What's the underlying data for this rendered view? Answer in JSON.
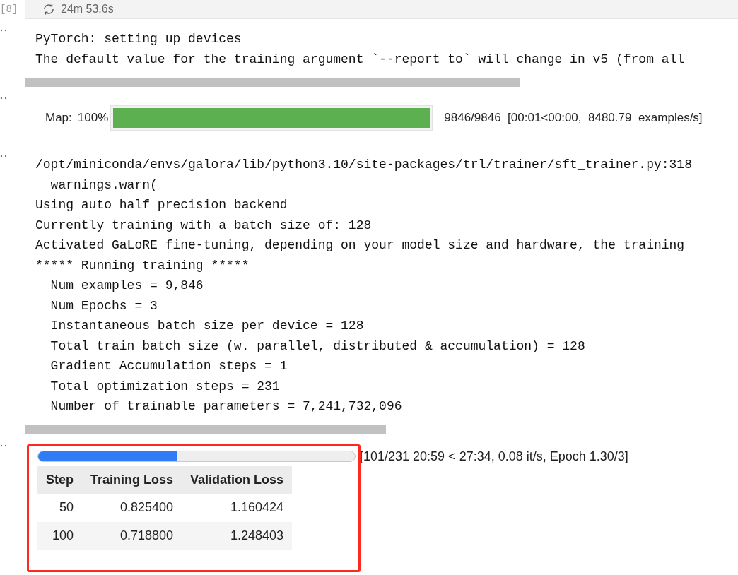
{
  "cell": {
    "execution_count": "[8]",
    "duration": "24m 53.6s"
  },
  "outputs": [
    {
      "kind": "stream",
      "lines": [
        "PyTorch: setting up devices",
        "The default value for the training argument `--report_to` will change in v5 (from all"
      ],
      "scrollbar": true
    },
    {
      "kind": "map_progress",
      "label": "Map:",
      "percent": "100%",
      "level": 1,
      "status": "9846/9846  [00:01<00:00,  8480.79  examples/s]"
    },
    {
      "kind": "stream",
      "lines": [
        "/opt/miniconda/envs/galora/lib/python3.10/site-packages/trl/trainer/sft_trainer.py:318",
        "  warnings.warn(",
        "Using auto half precision backend",
        "Currently training with a batch size of: 128",
        "Activated GaLoRE fine-tuning, depending on your model size and hardware, the training",
        "***** Running training *****",
        "  Num examples = 9,846",
        "  Num Epochs = 3",
        "  Instantaneous batch size per device = 128",
        "  Total train batch size (w. parallel, distributed & accumulation) = 128",
        "  Gradient Accumulation steps = 1",
        "  Total optimization steps = 231",
        "  Number of trainable parameters = 7,241,732,096"
      ],
      "scrollbar": true
    },
    {
      "kind": "training_progress",
      "level": 0.437,
      "status": "[101/231 20:59 < 27:34, 0.08 it/s, Epoch 1.30/3]",
      "highlighted": true,
      "table": {
        "columns": [
          "Step",
          "Training Loss",
          "Validation Loss"
        ],
        "rows": [
          [
            "50",
            "0.825400",
            "1.160424"
          ],
          [
            "100",
            "0.718800",
            "1.248403"
          ]
        ]
      }
    }
  ]
}
